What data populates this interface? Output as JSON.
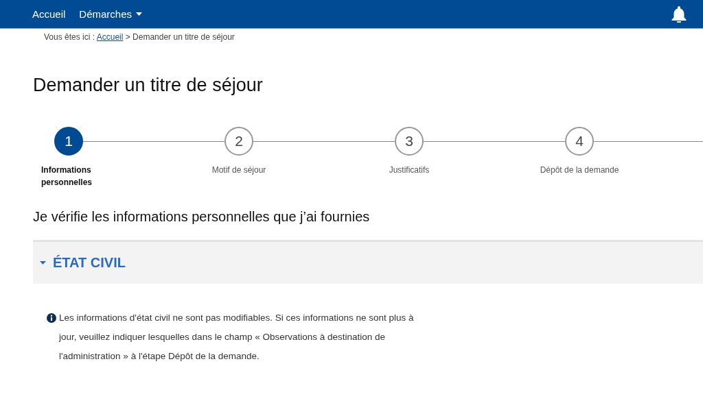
{
  "nav": {
    "items": [
      {
        "label": "Accueil",
        "kind": "link"
      },
      {
        "label": "Démarches",
        "kind": "dropdown"
      }
    ]
  },
  "breadcrumb": {
    "prefix": "Vous êtes ici :",
    "link": "Accueil",
    "current": "> Demander un titre de séjour"
  },
  "title": "Demander un titre de séjour",
  "steps": [
    {
      "number": "1",
      "label": "Informations personnelles",
      "selected": true
    },
    {
      "number": "2",
      "label": "Motif de séjour",
      "selected": false
    },
    {
      "number": "3",
      "label": "Justificatifs",
      "selected": false
    },
    {
      "number": "4",
      "label": "Dépôt de la demande",
      "selected": false
    }
  ],
  "heading": "Je vérifie les informations personnelles que j’ai fournies",
  "section": {
    "title": "ÉTAT CIVIL",
    "expanded": true,
    "info": "Les informations d'état civil ne sont pas modifiables. Si ces informations ne sont plus à jour, veuillez indiquer lesquelles dans le champ « Observations à destination de l'administration » à l'étape Dépôt de la demande."
  }
}
